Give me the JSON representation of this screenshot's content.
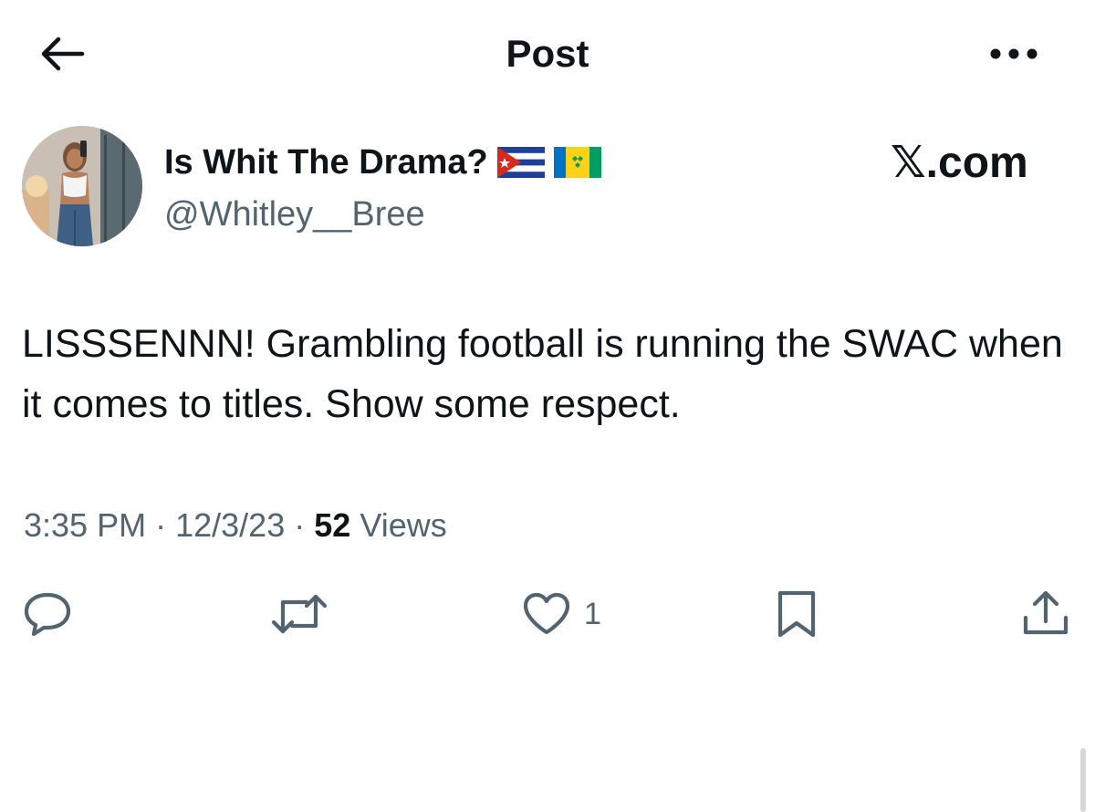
{
  "header": {
    "title": "Post",
    "back_icon": "arrow-left-icon",
    "more_icon": "more-horizontal-icon"
  },
  "author": {
    "display_name": "Is Whit The Drama?",
    "handle": "@Whitley__Bree",
    "flags": [
      "flag-cuba-icon",
      "flag-saint-vincent-icon"
    ]
  },
  "source": {
    "label": "𝕏.com"
  },
  "post": {
    "text": "LISSSENNN! Grambling football is running the SWAC when it comes to titles. Show some respect."
  },
  "meta": {
    "time": "3:35 PM",
    "separator": "·",
    "date": "12/3/23",
    "views_count": "52",
    "views_label": "Views"
  },
  "actions": {
    "reply_icon": "reply-icon",
    "repost_icon": "repost-icon",
    "like_icon": "heart-icon",
    "like_count": "1",
    "bookmark_icon": "bookmark-icon",
    "share_icon": "share-icon"
  },
  "colors": {
    "text_primary": "#0f1419",
    "text_secondary": "#536471",
    "background": "#ffffff"
  }
}
